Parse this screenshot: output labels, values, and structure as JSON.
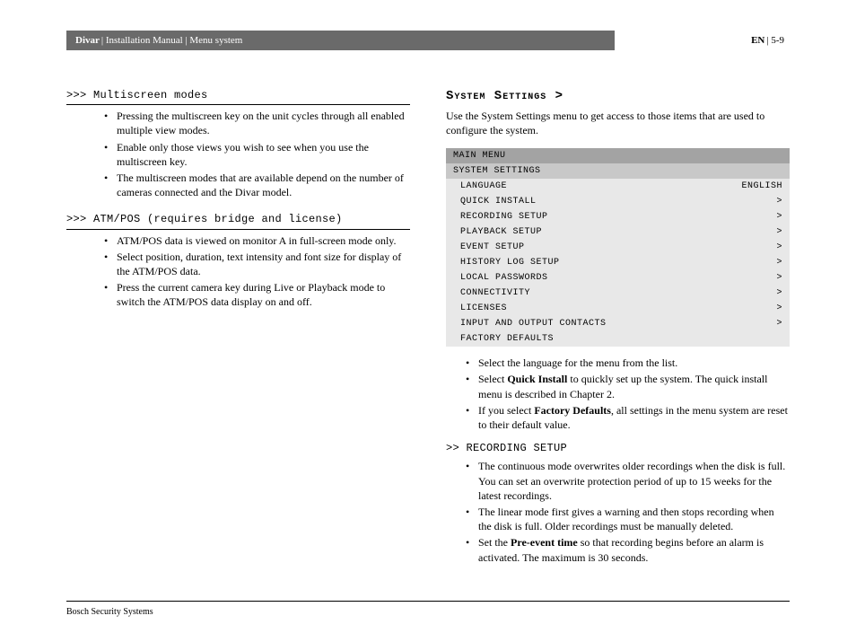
{
  "header": {
    "brand": "Divar",
    "crumbs": " | Installation Manual | Menu system",
    "lang": "EN",
    "page": " | 5-9"
  },
  "left": {
    "s1": {
      "title": ">>> Multiscreen modes",
      "b1": "Pressing the multiscreen key on the unit cycles through all enabled multiple view modes.",
      "b2": "Enable only those views you wish to see when you use the multiscreen key.",
      "b3": "The multiscreen modes that are available depend on the number of cameras connected and the Divar model."
    },
    "s2": {
      "title": ">>> ATM/POS (requires bridge and license)",
      "b1": "ATM/POS data is viewed on monitor A in full-screen mode only.",
      "b2": "Select position, duration, text intensity and font size for display of the ATM/POS data.",
      "b3": "Press the current camera key during Live or Playback mode to switch the ATM/POS data display on and off."
    }
  },
  "right": {
    "title": "System Settings >",
    "intro": "Use the System Settings menu to get access to those items that are used to configure the system.",
    "menu": {
      "main": "MAIN MENU",
      "sub": "SYSTEM SETTINGS",
      "lang_label": "LANGUAGE",
      "lang_value": "ENGLISH",
      "i1": "QUICK INSTALL",
      "i2": "RECORDING SETUP",
      "i3": "PLAYBACK SETUP",
      "i4": "EVENT SETUP",
      "i5": "HISTORY LOG SETUP",
      "i6": "LOCAL PASSWORDS",
      "i7": "CONNECTIVITY",
      "i8": "LICENSES",
      "i9": "INPUT AND OUTPUT CONTACTS",
      "i10": "FACTORY DEFAULTS",
      "arrow": ">"
    },
    "notes": {
      "n1": "Select the language for the menu from the list.",
      "n2a": "Select ",
      "n2b": "Quick Install",
      "n2c": " to quickly set up the system. The quick install menu is described in Chapter 2.",
      "n3a": "If you select ",
      "n3b": "Factory Defaults",
      "n3c": ", all settings in the menu system are reset to their default value."
    },
    "rec": {
      "title": ">> RECORDING SETUP",
      "b1": "The continuous mode overwrites older recordings when the disk is full. You can set an overwrite protection period of up to 15 weeks for the latest recordings.",
      "b2": "The linear mode first gives a warning and then stops recording when the disk is full. Older recordings must be manually deleted.",
      "b3a": "Set the ",
      "b3b": "Pre-event time",
      "b3c": " so that recording begins before an alarm is activated. The maximum is 30 seconds."
    }
  },
  "footer": "Bosch Security Systems"
}
